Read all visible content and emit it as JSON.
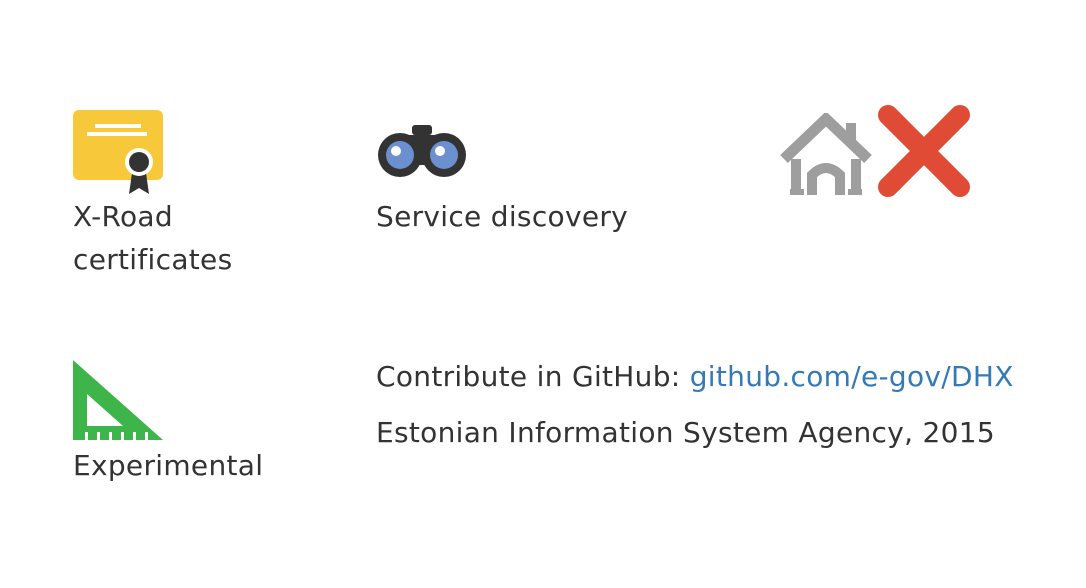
{
  "features": {
    "certificates": {
      "icon": "certificate-icon",
      "label_line1": "X-Road",
      "label_line2": "certificates"
    },
    "discovery": {
      "icon": "binoculars-icon",
      "label": "Service discovery"
    },
    "no_local": {
      "icons": [
        "house-icon",
        "cross-icon"
      ]
    },
    "experimental": {
      "icon": "set-square-icon",
      "label": "Experimental"
    }
  },
  "footer": {
    "contribute_text": "Contribute in GitHub: ",
    "github_link": "github.com/e-gov/DHX",
    "agency": "Estonian Information System Agency, 2015"
  },
  "colors": {
    "text": "#333333",
    "link": "#337ab7",
    "certificate": "#f7c93a",
    "binoculars": "#333333",
    "binocular_lens": "#6c8fd0",
    "house": "#9e9e9e",
    "cross": "#e04b35",
    "set_square": "#3db54a"
  }
}
